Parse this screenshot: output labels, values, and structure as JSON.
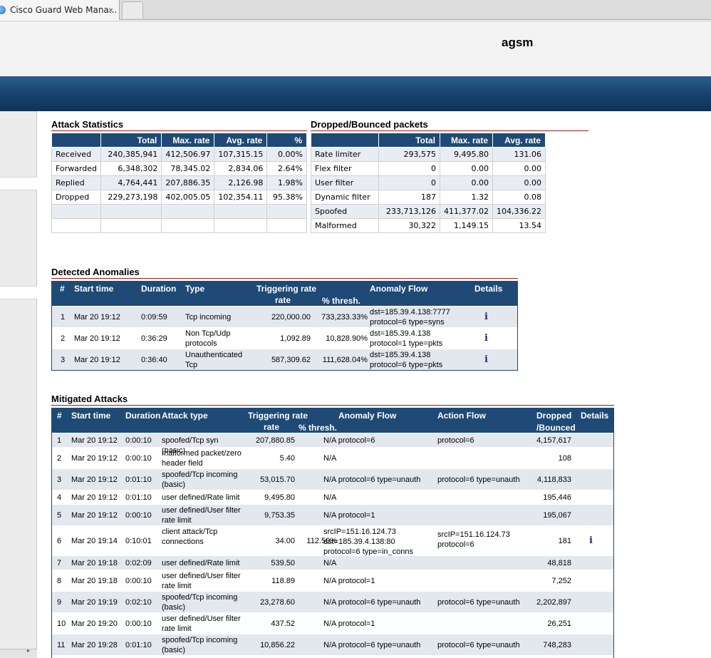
{
  "browser": {
    "tab_title": "Cisco Guard Web Mana...",
    "tab_close": "×"
  },
  "header": {
    "hostname": "agsm"
  },
  "attack_statistics": {
    "title": "Attack Statistics",
    "columns": [
      "",
      "Total",
      "Max. rate",
      "Avg. rate",
      "%"
    ],
    "rows": [
      [
        "Received",
        "240,385,941",
        "412,506.97",
        "107,315.15",
        "0.00%"
      ],
      [
        "Forwarded",
        "6,348,302",
        "78,345.02",
        "2,834.06",
        "2.64%"
      ],
      [
        "Replied",
        "4,764,441",
        "207,886.35",
        "2,126.98",
        "1.98%"
      ],
      [
        "Dropped",
        "229,273,198",
        "402,005.05",
        "102,354.11",
        "95.38%"
      ],
      [
        "",
        "",
        "",
        "",
        ""
      ],
      [
        "",
        "",
        "",
        "",
        ""
      ]
    ]
  },
  "dropped_bounced": {
    "title": "Dropped/Bounced packets",
    "columns": [
      "",
      "Total",
      "Max. rate",
      "Avg. rate"
    ],
    "rows": [
      [
        "Rate limiter",
        "293,575",
        "9,495.80",
        "131.06"
      ],
      [
        "Flex filter",
        "0",
        "0.00",
        "0.00"
      ],
      [
        "User filter",
        "0",
        "0.00",
        "0.00"
      ],
      [
        "Dynamic filter",
        "187",
        "1.32",
        "0.08"
      ],
      [
        "Spoofed",
        "233,713,126",
        "411,377.02",
        "104,336.22"
      ],
      [
        "Malformed",
        "30,322",
        "1,149.15",
        "13.54"
      ]
    ]
  },
  "detected_anomalies": {
    "title": "Detected Anomalies",
    "headers": {
      "num": "#",
      "start": "Start time",
      "duration": "Duration",
      "type": "Type",
      "trig": "Triggering rate",
      "rate": "rate",
      "thresh": "% thresh.",
      "flow": "Anomaly Flow",
      "details": "Details"
    },
    "rows": [
      {
        "num": "1",
        "start": "Mar 20 19:12",
        "duration": "0:09:59",
        "type": "Tcp incoming",
        "rate": "220,000.00",
        "thresh": "733,233.33%",
        "flow": "dst=185.39.4.138:7777 protocol=6 type=syns",
        "details": "i"
      },
      {
        "num": "2",
        "start": "Mar 20 19:12",
        "duration": "0:36:29",
        "type": "Non Tcp/Udp protocols",
        "rate": "1,092.89",
        "thresh": "10,828.90%",
        "flow": "dst=185.39.4.138 protocol=1 type=pkts",
        "details": "i"
      },
      {
        "num": "3",
        "start": "Mar 20 19:12",
        "duration": "0:36:40",
        "type": "Unauthenticated Tcp",
        "rate": "587,309.62",
        "thresh": "111,628.04%",
        "flow": "dst=185.39.4.138 protocol=6 type=pkts",
        "details": "i"
      }
    ]
  },
  "mitigated_attacks": {
    "title": "Mitigated Attacks",
    "headers": {
      "num": "#",
      "start": "Start time",
      "duration": "Duration",
      "type": "Attack type",
      "trig": "Triggering rate",
      "rate": "rate",
      "thresh": "% thresh.",
      "flow": "Anomaly Flow",
      "action": "Action Flow",
      "dropped": "Dropped",
      "bounced": "/Bounced",
      "details": "Details"
    },
    "rows": [
      {
        "num": "1",
        "start": "Mar 20 19:12",
        "duration": "0:00:10",
        "type": "spoofed/Tcp syn (basic)",
        "rate": "207,880.85",
        "thresh": "",
        "flow": "N/A protocol=6",
        "action": "protocol=6",
        "dropped": "4,157,617",
        "details": ""
      },
      {
        "num": "2",
        "start": "Mar 20 19:12",
        "duration": "0:00:10",
        "type": "malformed packet/zero header field",
        "rate": "5.40",
        "thresh": "",
        "flow": "N/A",
        "action": "",
        "dropped": "108",
        "details": ""
      },
      {
        "num": "3",
        "start": "Mar 20 19:12",
        "duration": "0:01:10",
        "type": "spoofed/Tcp incoming (basic)",
        "rate": "53,015.70",
        "thresh": "",
        "flow": "N/A protocol=6 type=unauth",
        "action": "protocol=6 type=unauth",
        "dropped": "4,118,833",
        "details": ""
      },
      {
        "num": "4",
        "start": "Mar 20 19:12",
        "duration": "0:01:10",
        "type": "user defined/Rate limit",
        "rate": "9,495.80",
        "thresh": "",
        "flow": "N/A",
        "action": "",
        "dropped": "195,446",
        "details": ""
      },
      {
        "num": "5",
        "start": "Mar 20 19:12",
        "duration": "0:00:10",
        "type": "user defined/User filter rate limit",
        "rate": "9,753.35",
        "thresh": "",
        "flow": "N/A protocol=1",
        "action": "",
        "dropped": "195,067",
        "details": ""
      },
      {
        "num": "6",
        "start": "Mar 20 19:14",
        "duration": "0:10:01",
        "type": "client attack/Tcp connections",
        "rate": "34.00",
        "thresh": "112.50%",
        "flow": "srcIP=151.16.124.73 dst=185.39.4.138:80 protocol=6 type=in_conns",
        "action": "srcIP=151.16.124.73 protocol=6",
        "dropped": "181",
        "details": "i"
      },
      {
        "num": "7",
        "start": "Mar 20 19:18",
        "duration": "0:02:09",
        "type": "user defined/Rate limit",
        "rate": "539.50",
        "thresh": "",
        "flow": "N/A",
        "action": "",
        "dropped": "48,818",
        "details": ""
      },
      {
        "num": "8",
        "start": "Mar 20 19:18",
        "duration": "0:00:10",
        "type": "user defined/User filter rate limit",
        "rate": "118.89",
        "thresh": "",
        "flow": "N/A protocol=1",
        "action": "",
        "dropped": "7,252",
        "details": ""
      },
      {
        "num": "9",
        "start": "Mar 20 19:19",
        "duration": "0:02:10",
        "type": "spoofed/Tcp incoming (basic)",
        "rate": "23,278.60",
        "thresh": "",
        "flow": "N/A protocol=6 type=unauth",
        "action": "protocol=6 type=unauth",
        "dropped": "2,202,897",
        "details": ""
      },
      {
        "num": "10",
        "start": "Mar 20 19:20",
        "duration": "0:00:10",
        "type": "user defined/User filter rate limit",
        "rate": "437.52",
        "thresh": "",
        "flow": "N/A protocol=1",
        "action": "",
        "dropped": "26,251",
        "details": ""
      },
      {
        "num": "11",
        "start": "Mar 20 19:28",
        "duration": "0:01:10",
        "type": "spoofed/Tcp incoming (basic)",
        "rate": "10,856.22",
        "thresh": "",
        "flow": "N/A protocol=6 type=unauth",
        "action": "protocol=6 type=unauth",
        "dropped": "748,283",
        "details": ""
      }
    ]
  }
}
